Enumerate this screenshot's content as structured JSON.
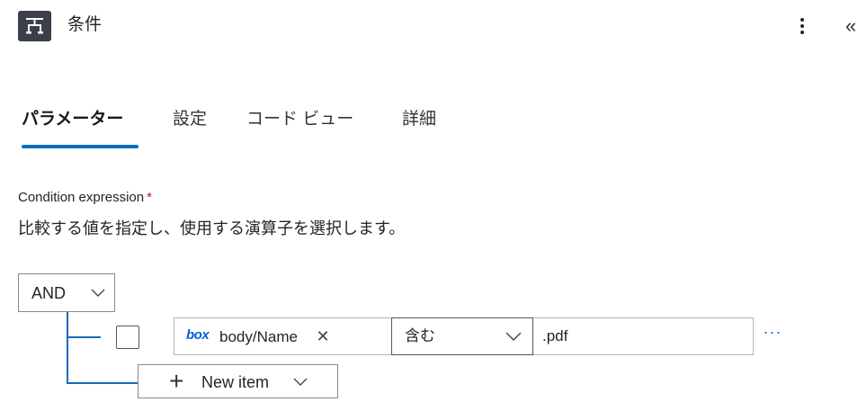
{
  "header": {
    "title": "条件",
    "app_icon": "condition-icon",
    "more_icon": "more-vertical-icon",
    "collapse_icon": "double-chevron-left-icon",
    "collapse_glyph": "«"
  },
  "tabs": [
    {
      "label": "パラメーター",
      "active": true
    },
    {
      "label": "設定",
      "active": false
    },
    {
      "label": "コード ビュー",
      "active": false
    },
    {
      "label": "詳細",
      "active": false
    }
  ],
  "condition": {
    "label": "Condition expression",
    "required_mark": "*",
    "description": "比較する値を指定し、使用する演算子を選択します。",
    "group_operator": "AND",
    "rows": [
      {
        "checked": false,
        "token_logo": "box",
        "token_label": "body/Name",
        "token_remove": "✕",
        "operator": "含む",
        "value": ".pdf",
        "more": "···"
      }
    ],
    "new_item": {
      "plus": "+",
      "label": "New item"
    }
  },
  "colors": {
    "accent": "#0f6cbd",
    "box_brand": "#0061d5",
    "required": "#c50f1f",
    "icon_bg": "#3b4048"
  }
}
